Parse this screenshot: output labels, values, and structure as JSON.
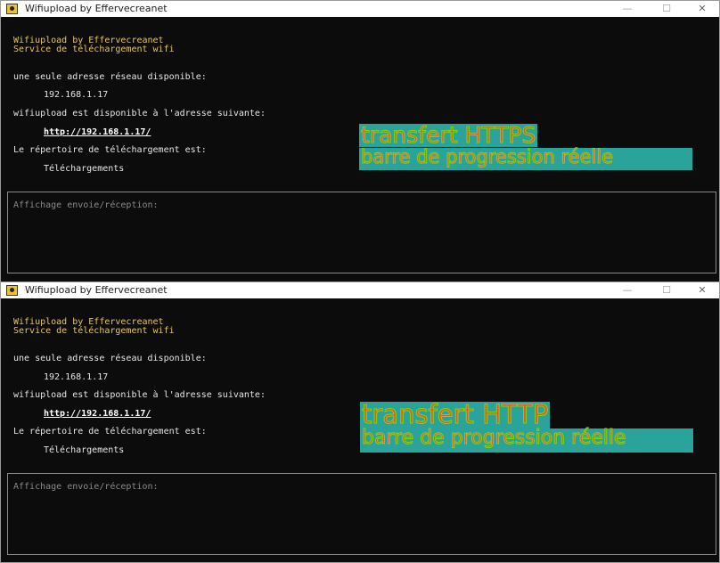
{
  "windows": [
    {
      "title": "Wifiupload by Effervecreanet",
      "header_line1": "Wifiupload by Effervecreanet",
      "header_line2": "Service de téléchargement wifi",
      "address_label": "une seule adresse réseau disponible:",
      "ip": "192.168.1.17",
      "available_label": "wifiupload est disponible à l'adresse suivante:",
      "url": "http://192.168.1.17/",
      "dir_label": "Le répertoire de téléchargement est:",
      "dir": "Téléchargements",
      "panel_label": "Affichage envoie/réception:",
      "overlay_line1": "transfert HTTPS",
      "overlay_line2": "barre de progression réelle"
    },
    {
      "title": "Wifiupload by Effervecreanet",
      "header_line1": "Wifiupload by Effervecreanet",
      "header_line2": "Service de téléchargement wifi",
      "address_label": "une seule adresse réseau disponible:",
      "ip": "192.168.1.17",
      "available_label": "wifiupload est disponible à l'adresse suivante:",
      "url": "http://192.168.1.17/",
      "dir_label": "Le répertoire de téléchargement est:",
      "dir": "Téléchargements",
      "panel_label": "Affichage envoie/réception:",
      "overlay_line1": "transfert HTTP",
      "overlay_line2": "barre de progression réelle"
    }
  ],
  "window_controls": {
    "minimize": "—",
    "maximize": "☐",
    "close": "✕"
  },
  "colors": {
    "console_bg": "#0c0c0c",
    "header_text": "#e7c65a",
    "overlay_bg": "#2aa39a",
    "overlay_text": "#e85b12"
  },
  "icons": {
    "app": "wifiupload-app-icon"
  }
}
